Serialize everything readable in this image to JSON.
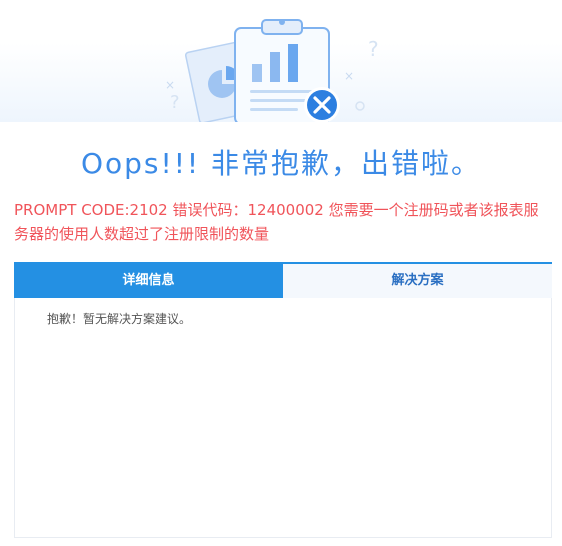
{
  "title": "Oops!!! 非常抱歉，出错啦。",
  "error_message": "PROMPT CODE:2102 错误代码：12400002 您需要一个注册码或者该报表服务器的使用人数超过了注册限制的数量",
  "tabs": [
    {
      "label": "详细信息",
      "active": true
    },
    {
      "label": "解决方案",
      "active": false
    }
  ],
  "panel": {
    "text": "抱歉！暂无解决方案建议。"
  },
  "colors": {
    "accent": "#2490e3",
    "title": "#3b8ae6",
    "error": "#f0545a"
  },
  "illustration": {
    "icons": [
      "clipboard-icon",
      "chart-icon",
      "error-x-icon",
      "question-mark-icon"
    ]
  }
}
